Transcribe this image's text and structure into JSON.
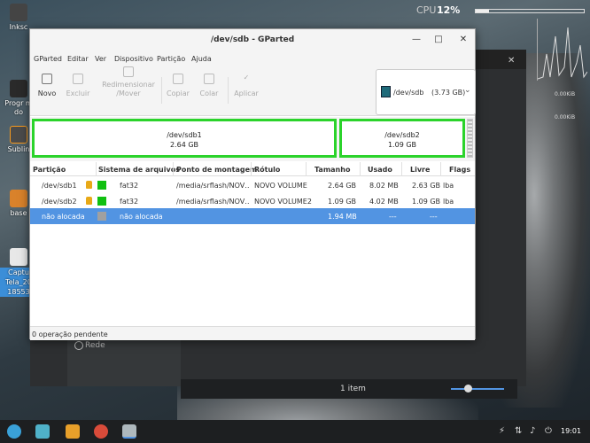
{
  "desktop": {
    "icons": [
      {
        "label": "Inksc",
        "color": "#444444"
      },
      {
        "label": "Progr m do",
        "color": "#2a2a2a"
      },
      {
        "label": "Sublin",
        "color": "#4b4b4b"
      },
      {
        "label": "base",
        "color": "#d9822b"
      },
      {
        "label": "Captu Tela_20 18553",
        "color": "#e8e8e8"
      }
    ]
  },
  "conky": {
    "cpu_label": "CPU",
    "cpu_value": "12%",
    "cpu_fill": 0.12,
    "net_a": "0.00KiB",
    "net_b": "0.00KiB"
  },
  "filemanager": {
    "sidebar_item": "Rede",
    "status_count": "1 item",
    "close": "✕"
  },
  "gparted": {
    "title": "/dev/sdb - GParted",
    "window_buttons": {
      "minimize": "—",
      "maximize": "□",
      "close": "✕"
    },
    "menu": [
      "GParted",
      "Editar",
      "Ver",
      "Dispositivo",
      "Partição",
      "Ajuda"
    ],
    "toolbar": {
      "new": "Novo",
      "delete": "Excluir",
      "resize": "Redimensionar\n/Mover",
      "copy": "Copiar",
      "paste": "Colar",
      "apply": "Aplicar"
    },
    "device": {
      "name": "/dev/sdb",
      "size": "(3.73 GB)",
      "chevron": "⌄"
    },
    "map": [
      {
        "name": "/dev/sdb1",
        "size": "2.64 GB"
      },
      {
        "name": "/dev/sdb2",
        "size": "1.09 GB"
      }
    ],
    "columns": [
      "Partição",
      "Sistema de arquivos",
      "Ponto de montagem",
      "Rótulo",
      "Tamanho",
      "Usado",
      "Livre",
      "Flags"
    ],
    "rows": [
      {
        "partition": "/dev/sdb1",
        "fs": "fat32",
        "mount": "/media/srflash/NOV…",
        "label": "NOVO VOLUME",
        "size": "2.64 GB",
        "used": "8.02 MB",
        "free": "2.63 GB",
        "flags": "lba",
        "color": "#10c010",
        "locked": true
      },
      {
        "partition": "/dev/sdb2",
        "fs": "fat32",
        "mount": "/media/srflash/NOV…",
        "label": "NOVO VOLUME2",
        "size": "1.09 GB",
        "used": "4.02 MB",
        "free": "1.09 GB",
        "flags": "lba",
        "color": "#10c010",
        "locked": true
      },
      {
        "partition": "não alocada",
        "fs": "não alocada",
        "mount": "",
        "label": "",
        "size": "1.94 MB",
        "used": "---",
        "free": "---",
        "flags": "",
        "color": "#a0a0a0",
        "locked": false
      }
    ],
    "status": "0 operação pendente"
  },
  "taskbar": {
    "clock": "19:01",
    "apps": [
      {
        "name": "start",
        "color": "#3aa1d8"
      },
      {
        "name": "store",
        "color": "#4fb1c9"
      },
      {
        "name": "files",
        "color": "#e8a02a"
      },
      {
        "name": "chrome",
        "color": "#d94b3a"
      },
      {
        "name": "gparted",
        "color": "#aeb8bd"
      }
    ]
  }
}
